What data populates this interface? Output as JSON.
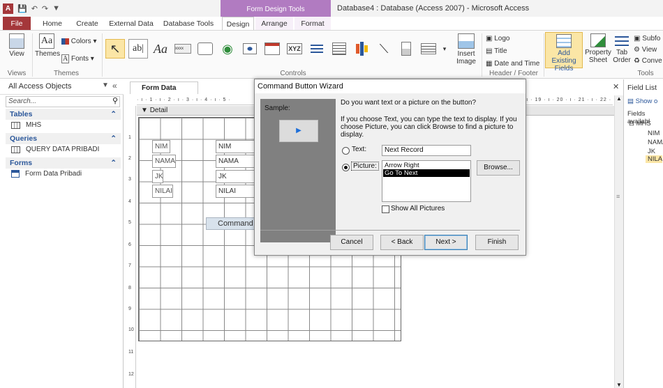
{
  "window": {
    "app_badge": "A",
    "title": "Database4 : Database (Access 2007)  -  Microsoft Access",
    "context_group": "Form Design Tools"
  },
  "tabs": [
    "File",
    "Home",
    "Create",
    "External Data",
    "Database Tools",
    "Design",
    "Arrange",
    "Format"
  ],
  "ribbon": {
    "views_group": {
      "view_label": "View",
      "group_label": "Views"
    },
    "themes_group": {
      "themes_label": "Themes",
      "colors_label": "Colors",
      "fonts_label": "Fonts",
      "group_label": "Themes"
    },
    "controls_group": {
      "group_label": "Controls",
      "insert_image_label": "Insert Image"
    },
    "header_footer_group": {
      "logo_label": "Logo",
      "title_label": "Title",
      "datetime_label": "Date and Time",
      "group_label": "Header / Footer"
    },
    "tools_group": {
      "add_fields_label": "Add Existing Fields",
      "property_sheet_label": "Property Sheet",
      "tab_order_label": "Tab Order",
      "subform_label": "Subfo",
      "view_code_label": "View",
      "convert_label": "Conve",
      "group_label": "Tools"
    }
  },
  "nav": {
    "header": "All Access Objects",
    "search_placeholder": "Search...",
    "sections": [
      {
        "label": "Tables",
        "items": [
          "MHS"
        ]
      },
      {
        "label": "Queries",
        "items": [
          "QUERY DATA PRIBADI"
        ]
      },
      {
        "label": "Forms",
        "items": [
          "Form Data Pribadi"
        ]
      }
    ]
  },
  "document": {
    "tab_label": "Form Data Pribadi",
    "ruler_left": "· ı · 1 · ı · 2 · ı · 3 · ı · 4 · ı · 5 ·",
    "ruler_right": "· ı · 19 · ı · 20 · ı · 21 · ı · 22 ·",
    "vruler": [
      "1",
      "2",
      "3",
      "4",
      "5",
      "6",
      "7",
      "8",
      "9",
      "10",
      "11",
      "12"
    ],
    "section_label": "Detail",
    "labels": [
      "NIM",
      "NAMA",
      "JK",
      "NILAI"
    ],
    "textboxes": [
      "NIM",
      "NAMA",
      "JK",
      "NILAI"
    ],
    "command_button_text": "Command"
  },
  "field_list": {
    "header": "Field List",
    "show_label": "Show o",
    "available_label": "Fields availabl",
    "table": "MHS",
    "fields": [
      "NIM",
      "NAMA",
      "JK",
      "NILAI"
    ]
  },
  "dialog": {
    "title": "Command Button Wizard",
    "sample_label": "Sample:",
    "question": "Do you want text or a picture on the button?",
    "description": "If you choose Text, you can type the text to display.  If you choose Picture, you can click Browse to find a picture to display.",
    "text_option_label": "Text:",
    "text_value": "Next Record",
    "picture_option_label": "Picture:",
    "picture_options": [
      "Arrow Right",
      "Go To Next"
    ],
    "selected_picture": "Go To Next",
    "browse_label": "Browse...",
    "show_all_label": "Show All Pictures",
    "buttons": {
      "cancel": "Cancel",
      "back": "< Back",
      "next": "Next >",
      "finish": "Finish"
    }
  }
}
